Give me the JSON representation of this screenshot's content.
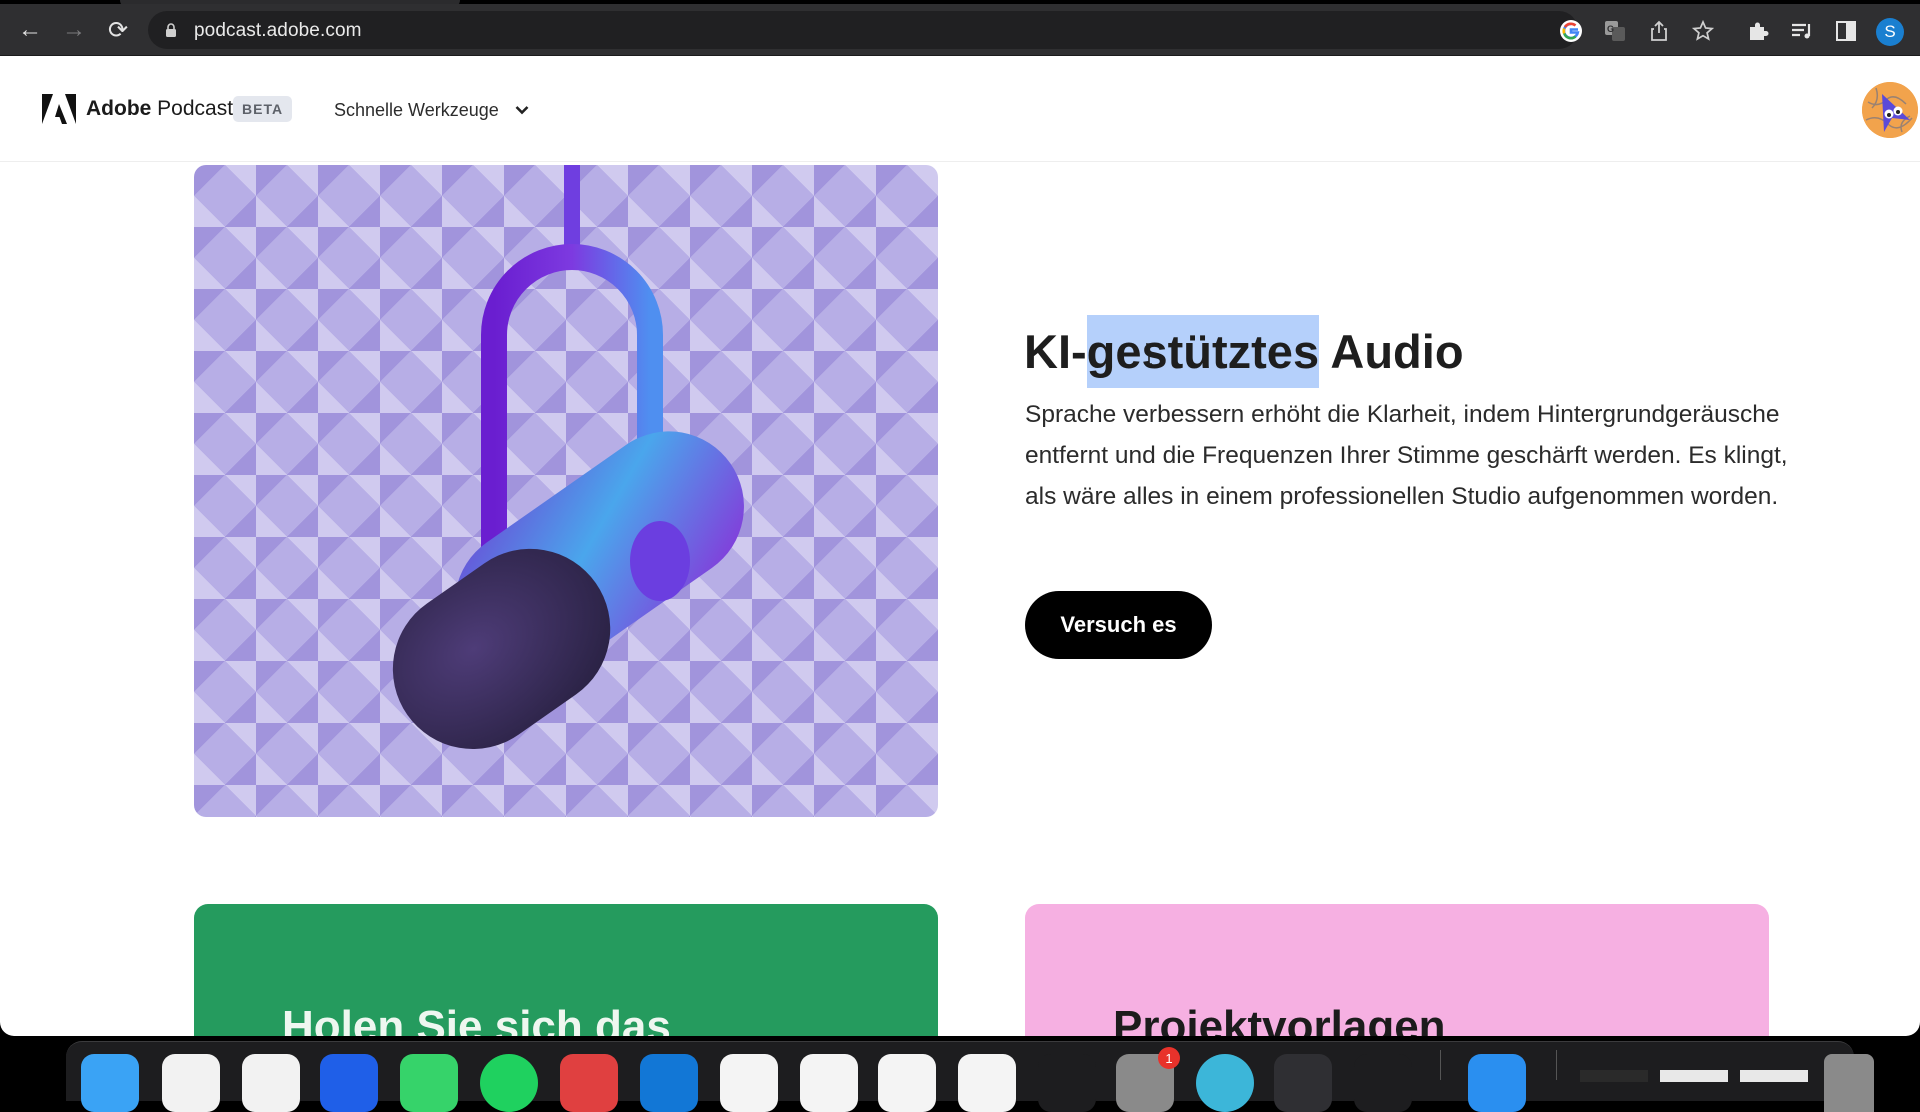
{
  "browser": {
    "url": "podcast.adobe.com",
    "nav": {
      "back": "←",
      "forward": "→",
      "reload": "⟳"
    },
    "omnibox_icons": [
      "google-icon",
      "translate-icon",
      "share-icon",
      "bookmark-star-icon"
    ],
    "toolbar_icons": [
      "extensions-icon",
      "reading-list-icon",
      "side-panel-icon"
    ],
    "profile_initial": "S"
  },
  "header": {
    "brand_bold": "Adobe",
    "brand_rest": " Podcast",
    "badge": "BETA",
    "menu_label": "Schnelle Werkzeuge"
  },
  "hero": {
    "title_prefix": "KI-",
    "title_selected": "gestütztes",
    "title_suffix": " Audio",
    "description": "Sprache verbessern erhöht die Klarheit, indem Hintergrundgeräusche entfernt und die Frequenzen Ihrer Stimme geschärft werden. Es klingt, als wäre alles in einem professionellen Studio aufgenommen worden.",
    "cta_label": "Versuch es",
    "image_alt": "Studio microphone illustration"
  },
  "cards": [
    {
      "title": "Holen Sie sich das",
      "color": "#259b5e"
    },
    {
      "title": "Projektvorlagen",
      "color": "#f6b0e2"
    }
  ],
  "dock": {
    "apps": [
      {
        "name": "finder",
        "color": "#3aa3f5"
      },
      {
        "name": "safari",
        "color": "#f2f2f2"
      },
      {
        "name": "chrome",
        "color": "#f2f2f2"
      },
      {
        "name": "zoom",
        "color": "#1f5fe8"
      },
      {
        "name": "whatsapp",
        "color": "#36d36a"
      },
      {
        "name": "spotify",
        "color": "#1fd15f"
      },
      {
        "name": "todoist",
        "color": "#e04040"
      },
      {
        "name": "trello",
        "color": "#1277d6"
      },
      {
        "name": "excel",
        "color": "#f4f4f4"
      },
      {
        "name": "powerpoint",
        "color": "#f4f4f4"
      },
      {
        "name": "word",
        "color": "#f4f4f4"
      },
      {
        "name": "imovie",
        "color": "#f4f4f4"
      },
      {
        "name": "google-drive",
        "color": "#1d1d1f"
      },
      {
        "name": "system-preferences",
        "color": "#8a8a8a"
      },
      {
        "name": "browser-blue",
        "color": "#3cb6d9"
      },
      {
        "name": "quicktime",
        "color": "#2f2f33"
      },
      {
        "name": "audio-app",
        "color": "#1d1d1f"
      },
      {
        "name": "app-store",
        "color": "#2a8ff0"
      }
    ],
    "system_prefs_badge": "1"
  }
}
